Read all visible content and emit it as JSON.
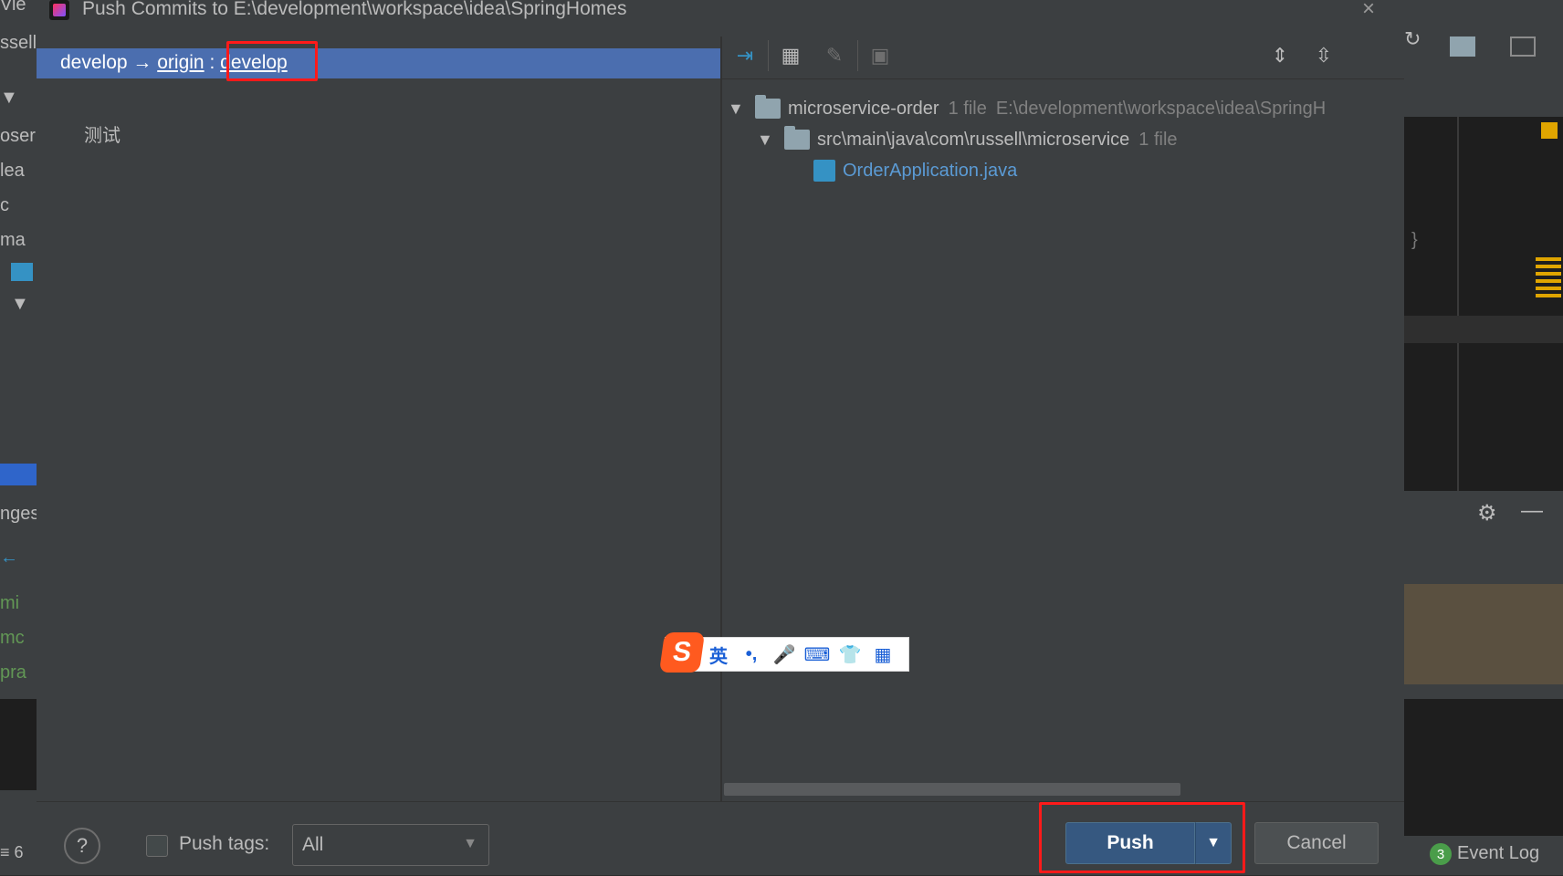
{
  "dialog": {
    "title": "Push Commits to E:\\development\\workspace\\idea\\SpringHomes",
    "close_glyph": "×"
  },
  "branch": {
    "local": "develop",
    "arrow": "→",
    "remote": "origin",
    "separator": ":",
    "target": "develop"
  },
  "commits": [
    {
      "message": "测试"
    }
  ],
  "tree": {
    "module": {
      "name": "microservice-order",
      "count": "1 file",
      "path": "E:\\development\\workspace\\idea\\SpringH"
    },
    "package": {
      "name": "src\\main\\java\\com\\russell\\microservice",
      "count": "1 file"
    },
    "file": {
      "name": "OrderApplication.java"
    }
  },
  "bottom": {
    "help": "?",
    "push_tags_label": "Push tags:",
    "tags_value": "All",
    "push_label": "Push",
    "cancel_label": "Cancel"
  },
  "ime": {
    "logo": "S",
    "items": [
      "英",
      "•,",
      "🎤",
      "⌨",
      "👕",
      "▦"
    ]
  },
  "background": {
    "left_fragments": [
      "Vie",
      "ssell",
      "oser",
      "lea",
      "c",
      "ma",
      "nges",
      "mi",
      "mc",
      "pra",
      "≡ 6"
    ],
    "event_log_count": "3",
    "event_log_label": "Event Log"
  },
  "colors": {
    "selection": "#4b6eaf",
    "highlight_box": "#ff1a1a",
    "push_button": "#365880",
    "file_link": "#5b9bd5"
  }
}
